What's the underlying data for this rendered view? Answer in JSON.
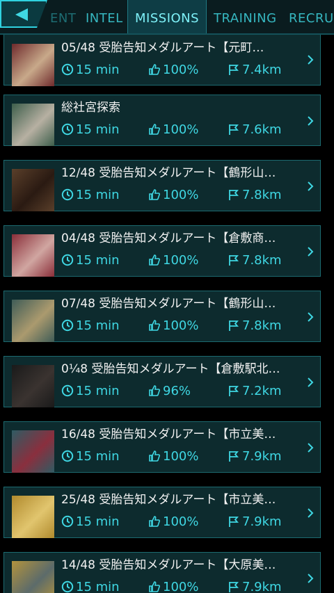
{
  "nav": {
    "back_label": "",
    "tabs": [
      {
        "label": "ENT"
      },
      {
        "label": "INTEL"
      },
      {
        "label": "MISSIONS"
      },
      {
        "label": "TRAINING"
      },
      {
        "label": "RECRU"
      }
    ],
    "active_tab": "MISSIONS"
  },
  "colors": {
    "accent": "#3fd7e3",
    "tab_active_text": "#7ef1f8",
    "card_bg": "#0d2b2e",
    "card_border": "#1c6a70"
  },
  "icons": {
    "back": "back-arrow-icon",
    "time": "clock-icon",
    "rating": "thumbs-up-icon",
    "distance": "flag-icon",
    "open": "chevron-right-icon"
  },
  "missions": [
    {
      "title": "05/48 受胎告知メダルアート【元町…",
      "time": "15 min",
      "rating": "100%",
      "distance": "7.4km",
      "thumb": [
        "#6e2a2c",
        "#c8a98a"
      ]
    },
    {
      "title": "総社宮探索",
      "time": "15 min",
      "rating": "100%",
      "distance": "7.6km",
      "thumb": [
        "#3d5e4b",
        "#b7b0a2"
      ]
    },
    {
      "title": "12/48 受胎告知メダルアート【鶴形山…",
      "time": "15 min",
      "rating": "100%",
      "distance": "7.8km",
      "thumb": [
        "#5a3f2a",
        "#2a1a12"
      ]
    },
    {
      "title": "04/48 受胎告知メダルアート【倉敷商…",
      "time": "15 min",
      "rating": "100%",
      "distance": "7.8km",
      "thumb": [
        "#8a2e39",
        "#d0a6a1"
      ]
    },
    {
      "title": "07/48 受胎告知メダルアート【鶴形山…",
      "time": "15 min",
      "rating": "100%",
      "distance": "7.8km",
      "thumb": [
        "#3f5c57",
        "#ab9a6e"
      ]
    },
    {
      "title": "0¼8 受胎告知メダルアート【倉敷駅北…",
      "time": "15 min",
      "rating": "96%",
      "distance": "7.2km",
      "thumb": [
        "#1a1a1a",
        "#3a3330"
      ]
    },
    {
      "title": "16/48 受胎告知メダルアート【市立美…",
      "time": "15 min",
      "rating": "100%",
      "distance": "7.9km",
      "thumb": [
        "#2f5b63",
        "#8a2f3e"
      ]
    },
    {
      "title": "25/48 受胎告知メダルアート【市立美…",
      "time": "15 min",
      "rating": "100%",
      "distance": "7.9km",
      "thumb": [
        "#b08a2d",
        "#e1c56e"
      ]
    },
    {
      "title": "14/48 受胎告知メダルアート【大原美…",
      "time": "15 min",
      "rating": "100%",
      "distance": "7.9km",
      "thumb": [
        "#b2933d",
        "#5c6b6a"
      ]
    }
  ]
}
